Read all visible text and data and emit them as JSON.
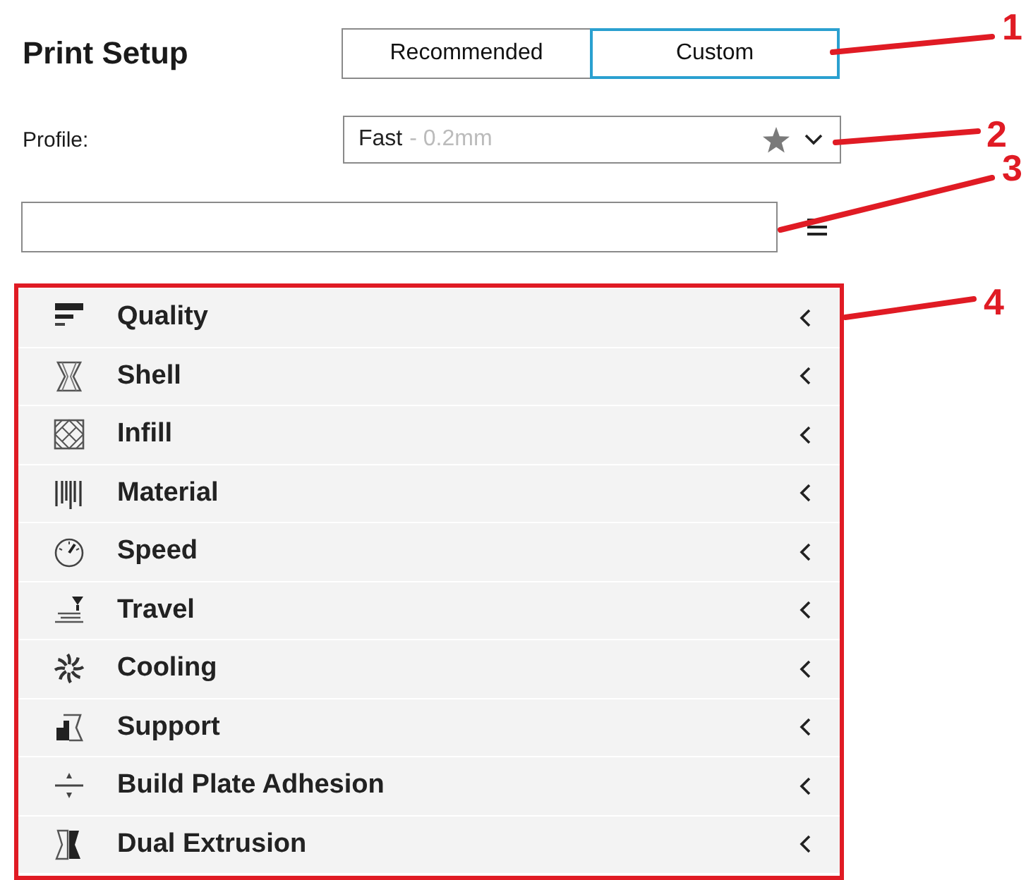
{
  "title": "Print Setup",
  "modes": [
    {
      "label": "Recommended",
      "selected": false
    },
    {
      "label": "Custom",
      "selected": true
    }
  ],
  "profile": {
    "label": "Profile:",
    "value": "Fast",
    "detail": "- 0.2mm"
  },
  "categories": [
    {
      "label": "Quality",
      "expanded": false
    },
    {
      "label": "Shell",
      "expanded": false
    },
    {
      "label": "Infill",
      "expanded": false
    },
    {
      "label": "Material",
      "expanded": false
    },
    {
      "label": "Speed",
      "expanded": false
    },
    {
      "label": "Travel",
      "expanded": false
    },
    {
      "label": "Cooling",
      "expanded": false
    },
    {
      "label": "Support",
      "expanded": false
    },
    {
      "label": "Build Plate Adhesion",
      "expanded": false
    },
    {
      "label": "Dual Extrusion",
      "expanded": false
    }
  ],
  "callouts": [
    {
      "label": "1"
    },
    {
      "label": "2"
    },
    {
      "label": "3"
    },
    {
      "label": "4"
    }
  ]
}
